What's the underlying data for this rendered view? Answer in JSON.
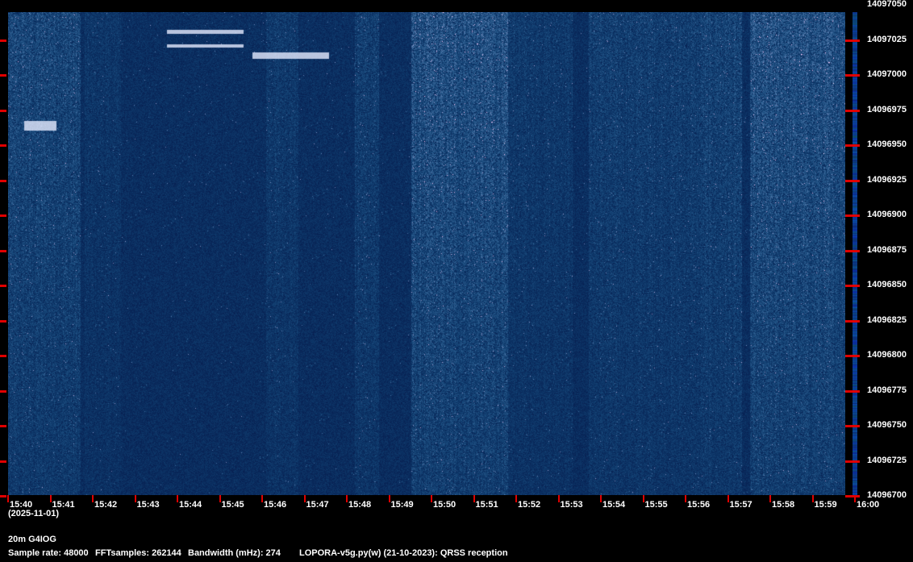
{
  "chart_data": {
    "type": "heatmap",
    "x_tick_labels": [
      "15:40",
      "15:41",
      "15:42",
      "15:43",
      "15:44",
      "15:45",
      "15:46",
      "15:47",
      "15:48",
      "15:49",
      "15:50",
      "15:51",
      "15:52",
      "15:53",
      "15:54",
      "15:55",
      "15:56",
      "15:57",
      "15:58",
      "15:59",
      "16:00"
    ],
    "x_range": [
      "15:40",
      "16:00"
    ],
    "date_label": "(2025-11-01)",
    "y_tick_labels": [
      "14097050",
      "14097025",
      "14097000",
      "14096975",
      "14096950",
      "14096925",
      "14096900",
      "14096875",
      "14096850",
      "14096825",
      "14096800",
      "14096775",
      "14096750",
      "14096725",
      "14096700"
    ],
    "y_range_hz": [
      14096700,
      14097050
    ],
    "colormap": [
      "#000a3c",
      "#0a2c78",
      "#3e6fb0",
      "#e8f0ff"
    ],
    "tick_color": "#e00000"
  },
  "footer": {
    "station": "20m G4IOG",
    "sample_rate": "Sample rate: 48000",
    "fft_samples": "FFTsamples: 262144",
    "bandwidth": "Bandwidth (mHz): 274",
    "software": "LOPORA-v5g.py(w) (21-10-2023): QRSS reception"
  }
}
